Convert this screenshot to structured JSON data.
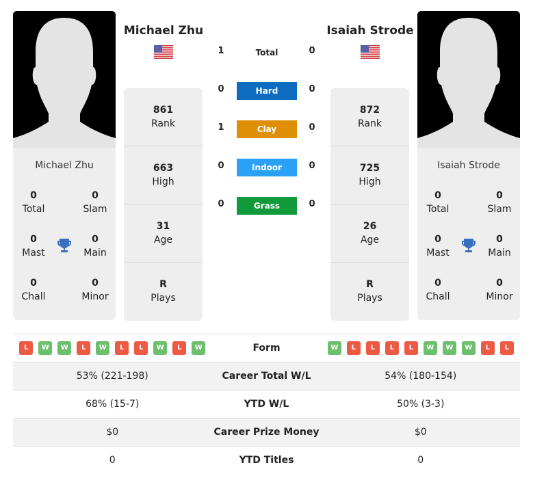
{
  "player1": {
    "name": "Michael Zhu",
    "country_flag": "us-flag-icon",
    "rank": "861",
    "rank_label": "Rank",
    "high": "663",
    "high_label": "High",
    "age": "31",
    "age_label": "Age",
    "plays": "R",
    "plays_label": "Plays",
    "titles": {
      "total": "0",
      "total_label": "Total",
      "slam": "0",
      "slam_label": "Slam",
      "mast": "0",
      "mast_label": "Mast",
      "main": "0",
      "main_label": "Main",
      "chall": "0",
      "chall_label": "Chall",
      "minor": "0",
      "minor_label": "Minor"
    },
    "form": [
      "L",
      "W",
      "W",
      "L",
      "W",
      "L",
      "L",
      "W",
      "L",
      "W"
    ],
    "career_wl": "53% (221-198)",
    "ytd_wl": "68% (15-7)",
    "prize": "$0",
    "ytd_titles": "0"
  },
  "player2": {
    "name": "Isaiah Strode",
    "country_flag": "us-flag-icon",
    "rank": "872",
    "rank_label": "Rank",
    "high": "725",
    "high_label": "High",
    "age": "26",
    "age_label": "Age",
    "plays": "R",
    "plays_label": "Plays",
    "titles": {
      "total": "0",
      "total_label": "Total",
      "slam": "0",
      "slam_label": "Slam",
      "mast": "0",
      "mast_label": "Mast",
      "main": "0",
      "main_label": "Main",
      "chall": "0",
      "chall_label": "Chall",
      "minor": "0",
      "minor_label": "Minor"
    },
    "form": [
      "W",
      "L",
      "L",
      "L",
      "L",
      "W",
      "W",
      "W",
      "L",
      "L"
    ],
    "career_wl": "54% (180-154)",
    "ytd_wl": "50% (3-3)",
    "prize": "$0",
    "ytd_titles": "0"
  },
  "h2h": {
    "total": {
      "label": "Total",
      "p1": "1",
      "p2": "0"
    },
    "surfaces": [
      {
        "label": "Hard",
        "p1": "0",
        "p2": "0",
        "color": "#0e6cc0"
      },
      {
        "label": "Clay",
        "p1": "1",
        "p2": "0",
        "color": "#de8f05"
      },
      {
        "label": "Indoor",
        "p1": "0",
        "p2": "0",
        "color": "#2aa1f5"
      },
      {
        "label": "Grass",
        "p1": "0",
        "p2": "0",
        "color": "#109a3c"
      }
    ]
  },
  "compare": {
    "form_label": "Form",
    "career_wl_label": "Career Total W/L",
    "ytd_wl_label": "YTD W/L",
    "prize_label": "Career Prize Money",
    "ytd_titles_label": "YTD Titles"
  },
  "colors": {
    "win": "#6cbf6c",
    "loss": "#ec5a44",
    "trophy": "#3a6fbf"
  }
}
